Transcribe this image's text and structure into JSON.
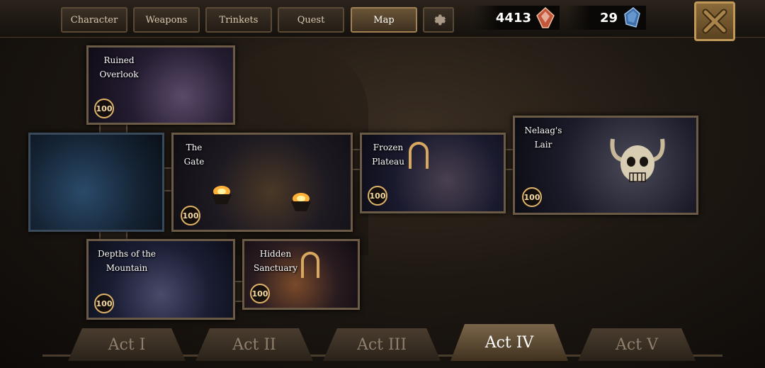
{
  "tabs": [
    {
      "label": "Character",
      "active": false
    },
    {
      "label": "Weapons",
      "active": false
    },
    {
      "label": "Trinkets",
      "active": false
    },
    {
      "label": "Quest",
      "active": false
    },
    {
      "label": "Map",
      "active": true
    }
  ],
  "settings_icon": "gear-icon",
  "resources": {
    "gems": {
      "value": "4413",
      "icon": "red-gem-icon",
      "color": "#c2553a"
    },
    "crystals": {
      "value": "29",
      "icon": "blue-crystal-icon",
      "color": "#3f6fa8"
    }
  },
  "close_icon": "close-icon",
  "locations": [
    {
      "name": "Ruined Overlook",
      "line1": "Ruined",
      "line2": "Overlook",
      "level": "100"
    },
    {
      "name": "",
      "line1": "",
      "line2": "",
      "level": ""
    },
    {
      "name": "The Gate",
      "line1": "The",
      "line2": "Gate",
      "level": "100"
    },
    {
      "name": "Frozen Plateau",
      "line1": "Frozen",
      "line2": "Plateau",
      "level": "100"
    },
    {
      "name": "Nelaag's Lair",
      "line1": "Nelaag's",
      "line2": "Lair",
      "level": "100"
    },
    {
      "name": "Depths of the Mountain",
      "line1": "Depths of the",
      "line2": "Mountain",
      "level": "100"
    },
    {
      "name": "Hidden Sanctuary",
      "line1": "Hidden",
      "line2": "Sanctuary",
      "level": "100"
    }
  ],
  "acts": [
    {
      "label": "Act I",
      "active": false
    },
    {
      "label": "Act II",
      "active": false
    },
    {
      "label": "Act III",
      "active": false
    },
    {
      "label": "Act IV",
      "active": true
    },
    {
      "label": "Act V",
      "active": false
    }
  ]
}
